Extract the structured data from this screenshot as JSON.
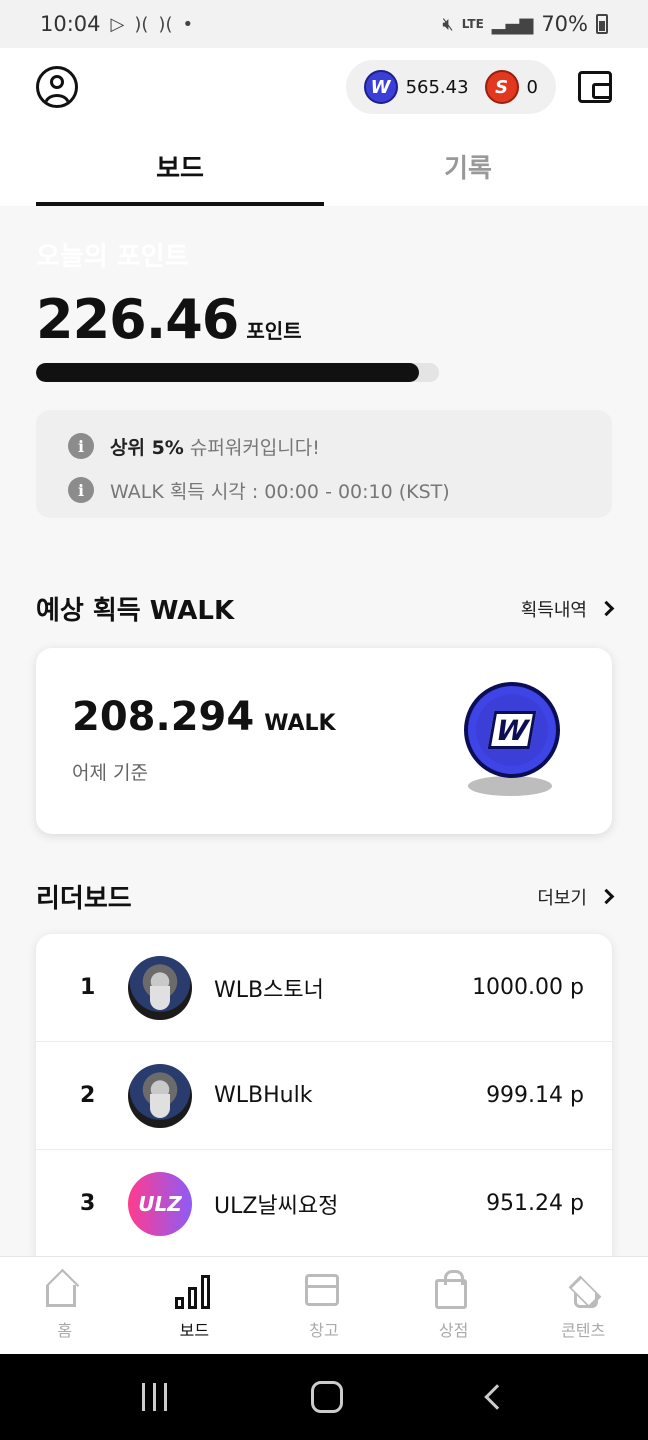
{
  "status_bar": {
    "time": "10:04",
    "battery": "70%",
    "network": "LTE"
  },
  "header": {
    "walk_balance": "565.43",
    "s_balance": "0",
    "walk_coin_letter": "W",
    "s_coin_letter": "S"
  },
  "tabs": [
    {
      "label": "보드",
      "active": true
    },
    {
      "label": "기록",
      "active": false
    }
  ],
  "today": {
    "title": "오늘의 포인트",
    "points": "226.46",
    "unit": "포인트",
    "progress_fraction": 0.95
  },
  "info": {
    "line1_strong": "상위 5%",
    "line1_rest": " 슈퍼워커입니다!",
    "line2": "WALK 획득 시각 : 00:00 - 00:10 (KST)"
  },
  "expected": {
    "title": "예상 획득 WALK",
    "link": "획득내역",
    "value": "208.294",
    "unit": "WALK",
    "sub": "어제 기준"
  },
  "leaderboard": {
    "title": "리더보드",
    "link": "더보기",
    "rows": [
      {
        "rank": "1",
        "name": "WLB스토너",
        "score": "1000.00 p",
        "avatar": "wizard"
      },
      {
        "rank": "2",
        "name": "WLBHulk",
        "score": "999.14 p",
        "avatar": "wizard"
      },
      {
        "rank": "3",
        "name": "ULZ날씨요정",
        "score": "951.24 p",
        "avatar": "ulz",
        "avatar_text": "ULZ"
      }
    ]
  },
  "bottom_nav": [
    {
      "label": "홈",
      "icon": "home-icon"
    },
    {
      "label": "보드",
      "icon": "bar-chart-icon",
      "active": true
    },
    {
      "label": "창고",
      "icon": "box-icon"
    },
    {
      "label": "상점",
      "icon": "shopping-bag-icon"
    },
    {
      "label": "콘텐츠",
      "icon": "graduation-cap-icon"
    }
  ],
  "colors": {
    "walk_coin": "#3b3fd8",
    "s_coin": "#e2381f",
    "progress": "#111111",
    "accent_text": "#111111"
  }
}
